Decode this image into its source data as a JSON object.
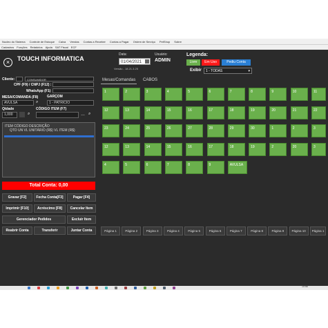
{
  "menubar": [
    "Nucleo do Sistema",
    "Controle de Estoque",
    "Caixa",
    "Vendas",
    "Contas a Receber",
    "Contas a Pagar",
    "Ordem de Serviço",
    "PetShop",
    "Sobre"
  ],
  "toolbar": [
    "Cadastros",
    "Funções",
    "Relatórios",
    "Ajuda",
    "SAT Fiscal",
    "ECF"
  ],
  "company": "TOUCH INFORMATICA",
  "date_label": "Data:",
  "date_value": "01/04/2021",
  "user_label": "Usuário:",
  "user_value": "ADMIN",
  "version": "Versão - 18.21.3.25",
  "legend": {
    "title": "Legenda:",
    "items": [
      {
        "label": "Livre",
        "color": "#6ab04c"
      },
      {
        "label": "Em Uso",
        "color": "#ff1a1a"
      },
      {
        "label": "Pediu Conta",
        "color": "#2a7fd4"
      }
    ]
  },
  "exibir": {
    "label": "Exibir",
    "value": "1 - TODAS"
  },
  "left": {
    "cliente_label": "Cliente:",
    "consumidor": "CONSUMIDOR",
    "cpf_label": "CPF (F9) / CNPJ (F12) :",
    "whatsapp_label": "WhatsApp (F1)",
    "mesa_label": "MESA/COMANDA (F8)",
    "garcom_label": "GARÇOM",
    "mesa_value": "AVULSA",
    "garcom_value": "1 - PATRICIO",
    "qtd_label": "Qtdade",
    "codigo_label": "CÓDIGO ITEM (F7)",
    "qtd_value": "1,000",
    "item_header1": "ITEM CÓDIGO    DESCRIÇÃO",
    "item_header2": "QTD  UN  VL UNITÁRIO (R$) VL ITEM (R$)",
    "total": "Total Conta: 0,00"
  },
  "buttons": [
    [
      "Gravar [F2]",
      "Fecha Conta[F3]",
      "Pagar [F4]"
    ],
    [
      "Imprimir [F10]",
      "Acréscimo [F8]",
      "Cancelar Item"
    ],
    [
      "Gerenciador Pedidos",
      "Excluir Item"
    ],
    [
      "Reabrir Conta",
      "Transferir",
      "Juntar Conta"
    ]
  ],
  "tabs": [
    "Mesas/Comandas",
    "CABOS"
  ],
  "grid": [
    [
      "1",
      "2",
      "3",
      "4",
      "5",
      "6",
      "7",
      "8",
      "9",
      "10",
      "11"
    ],
    [
      "12",
      "13",
      "14",
      "15",
      "16",
      "17",
      "18",
      "19",
      "20",
      "21",
      "22"
    ],
    [
      "23",
      "24",
      "25",
      "26",
      "27",
      "28",
      "29",
      "30",
      "1",
      "2",
      "3"
    ],
    [
      "12",
      "13",
      "14",
      "15",
      "16",
      "17",
      "18",
      "19",
      "2",
      "20",
      "3"
    ],
    [
      "4",
      "5",
      "6",
      "7",
      "8",
      "9",
      "AVULSA"
    ]
  ],
  "pages": [
    "Página 1",
    "Página 2",
    "Página 3",
    "Página 4",
    "Página 5",
    "Página 6",
    "Página 7",
    "Página 8",
    "Página 9",
    "Página 10",
    "Página 1"
  ],
  "clock": {
    "time": "10:56",
    "date": "01/04/2021"
  }
}
